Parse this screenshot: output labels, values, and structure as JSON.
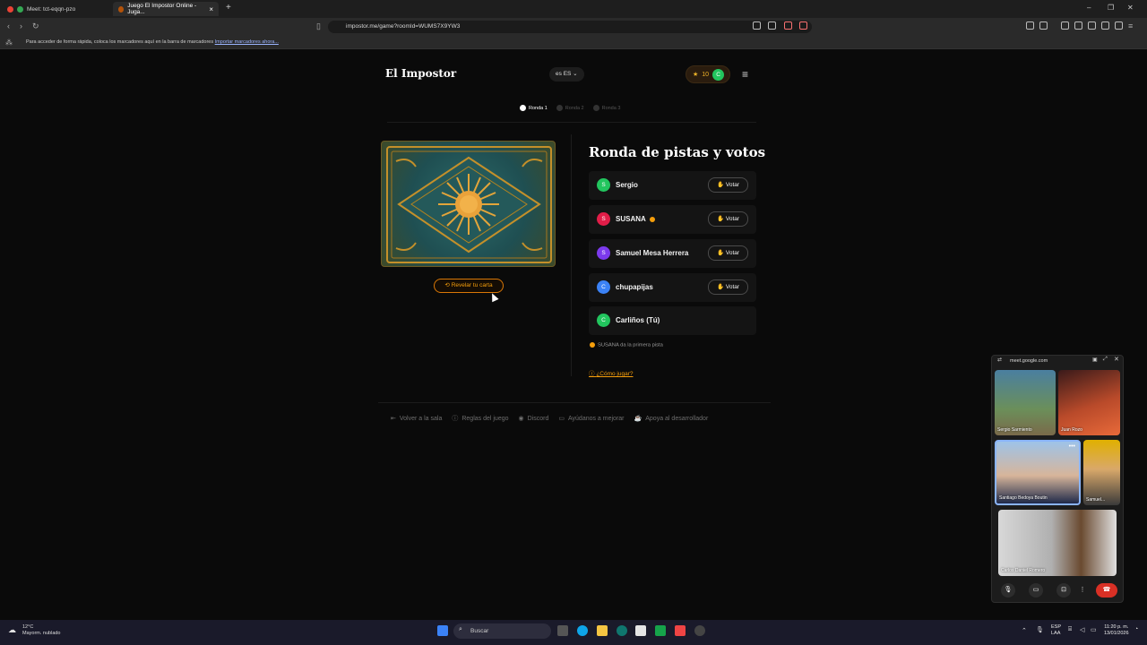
{
  "browser": {
    "tabs": [
      {
        "title": "Meet: tct-eqqn-pzo",
        "active": false
      },
      {
        "title": "Juego El Impostor Online - Juga...",
        "active": true
      }
    ],
    "url": "impostor.me/game?roomId=WUMS7X9YW3",
    "bookmarks_text": "Para acceder de forma rápida, coloca los marcadores aquí en la barra de marcadores",
    "bookmarks_link": "Importar marcadores ahora..."
  },
  "app": {
    "logo": "El Impostor",
    "language": "ES",
    "language_flag": "es",
    "points": "10",
    "user_initial": "C"
  },
  "rounds": [
    {
      "label": "Ronda 1",
      "active": true
    },
    {
      "label": "Ronda 2",
      "active": false
    },
    {
      "label": "Ronda 3",
      "active": false
    }
  ],
  "card": {
    "reveal_label": "Revelar tu carta"
  },
  "panel": {
    "title": "Ronda de pistas y votos",
    "vote_label": "Votar",
    "players": [
      {
        "initial": "S",
        "name": "Sergio",
        "color": "#22c55e",
        "can_vote": true,
        "marker": false
      },
      {
        "initial": "S",
        "name": "SUSANA",
        "color": "#e11d48",
        "can_vote": true,
        "marker": true
      },
      {
        "initial": "S",
        "name": "Samuel Mesa Herrera",
        "color": "#7c3aed",
        "can_vote": true,
        "marker": false
      },
      {
        "initial": "C",
        "name": "chupapijas",
        "color": "#3b82f6",
        "can_vote": true,
        "marker": false
      },
      {
        "initial": "C",
        "name": "Carliños (Tú)",
        "color": "#22c55e",
        "can_vote": false,
        "marker": false
      }
    ],
    "hint": "SUSANA da la primera pista",
    "howto": "¿Cómo jugar?"
  },
  "footer": [
    {
      "label": "Volver a la sala",
      "icon": "exit-icon"
    },
    {
      "label": "Reglas del juego",
      "icon": "info-icon"
    },
    {
      "label": "Discord",
      "icon": "discord-icon"
    },
    {
      "label": "Ayúdanos a mejorar",
      "icon": "chat-icon"
    },
    {
      "label": "Apoya al desarrollador",
      "icon": "coffee-icon"
    }
  ],
  "meet": {
    "domain": "meet.google.com",
    "participants": [
      {
        "name": "Sergio Sarmiento"
      },
      {
        "name": "Juan Rozo"
      },
      {
        "name": "Santiago Bedoya Boutin"
      },
      {
        "name": "Samuel..."
      },
      {
        "name": "Carlos Daniel Romero"
      }
    ]
  },
  "taskbar": {
    "weather_temp": "12°C",
    "weather_desc": "Mayorm. nublado",
    "search": "Buscar",
    "lang_top": "ESP",
    "lang_bottom": "LAA",
    "time": "11:20 p. m.",
    "date": "13/01/2026"
  },
  "colors": {
    "accent": "#f59e0b",
    "background": "#0a0a0a"
  }
}
